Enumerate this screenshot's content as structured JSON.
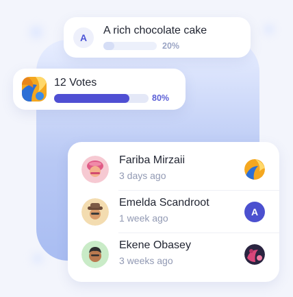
{
  "poll_option": {
    "avatar_letter": "A",
    "title": "A rich chocolate cake",
    "percent_label": "20%",
    "percent": 20
  },
  "votes": {
    "title": "12 Votes",
    "percent_label": "80%",
    "percent": 80
  },
  "voters": [
    {
      "name": "Fariba Mirzaii",
      "time": "3 days ago",
      "vote_icon": "yellow-blue-swirl-icon"
    },
    {
      "name": "Emelda Scandroot",
      "time": "1 week ago",
      "vote_letter": "A"
    },
    {
      "name": "Ekene Obasey",
      "time": "3 weeks ago",
      "vote_icon": "pink-dark-swirl-icon"
    }
  ],
  "colors": {
    "accent": "#4f4fd3",
    "muted_bar": "#d6def6",
    "background": "#f3f5fc"
  }
}
